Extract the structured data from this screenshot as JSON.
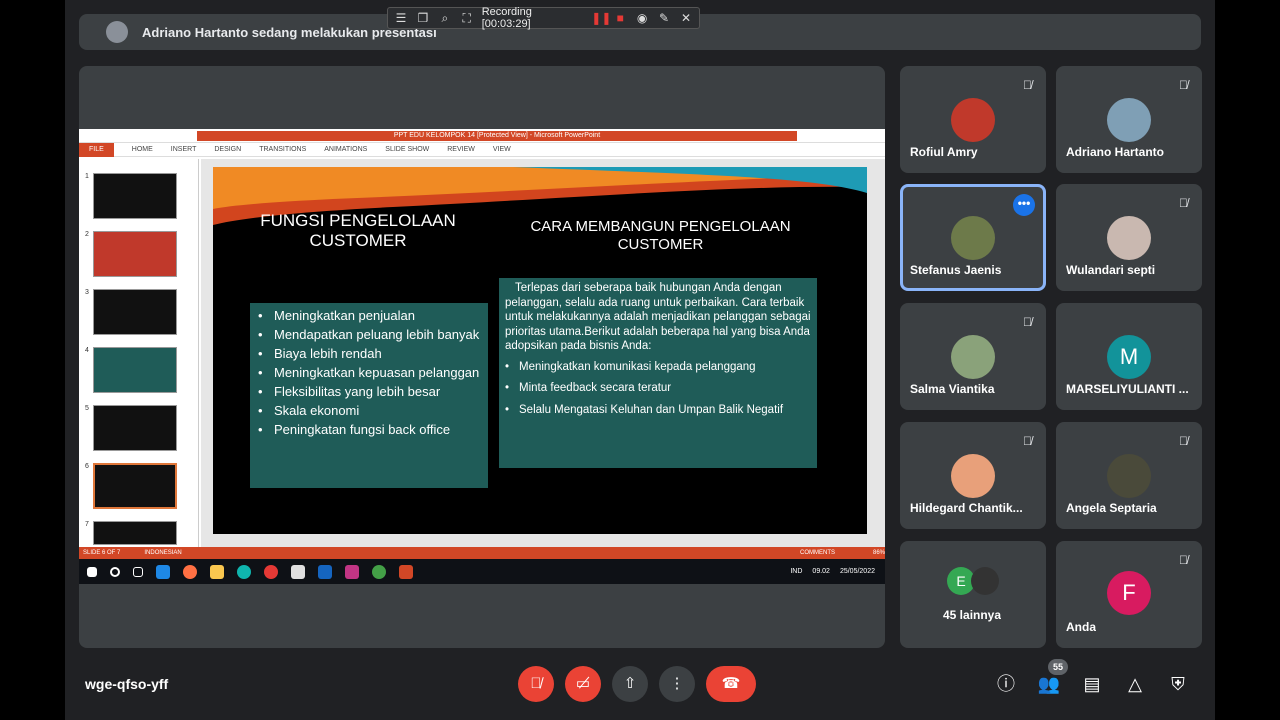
{
  "banner": {
    "text": "Adriano Hartanto sedang melakukan presentasi"
  },
  "recording": {
    "label": "Recording [00:03:29]"
  },
  "ppt": {
    "window_title": "PPT EDU KELOMPOK 14 [Protected View] - Microsoft PowerPoint",
    "ribbon_tabs": [
      "FILE",
      "HOME",
      "INSERT",
      "DESIGN",
      "TRANSITIONS",
      "ANIMATIONS",
      "SLIDE SHOW",
      "REVIEW",
      "VIEW"
    ],
    "thumbnail_numbers": [
      "1",
      "2",
      "3",
      "4",
      "5",
      "6",
      "7"
    ],
    "selected_slide": 6,
    "status_slide": "SLIDE 6 OF 7",
    "status_lang": "INDONESIAN",
    "status_comments": "COMMENTS",
    "status_zoom": "86%"
  },
  "slide": {
    "title_left": "FUNGSI PENGELOLAAN CUSTOMER",
    "title_right": "CARA MEMBANGUN PENGELOLAAN CUSTOMER",
    "left_bullets": [
      "Meningkatkan penjualan",
      "Mendapatkan peluang lebih banyak",
      "Biaya lebih rendah",
      "Meningkatkan kepuasan pelanggan",
      "Fleksibilitas yang lebih besar",
      "Skala ekonomi",
      "Peningkatan fungsi back office"
    ],
    "right_paragraph": "Terlepas dari seberapa baik hubungan Anda dengan pelanggan, selalu ada ruang untuk perbaikan. Cara terbaik untuk melakukannya adalah menjadikan pelanggan sebagai prioritas utama.Berikut adalah beberapa hal yang bisa Anda adopsikan pada bisnis Anda:",
    "right_bullets": [
      "Meningkatkan komunikasi kepada pelanggang",
      "Minta feedback secara teratur",
      "Selalu Mengatasi Keluhan dan Umpan Balik Negatif"
    ]
  },
  "taskbar": {
    "lang": "IND",
    "time": "09.02",
    "date": "25/05/2022"
  },
  "participants": [
    {
      "name": "Rofiul Amry",
      "initial": "",
      "color": "#c0392b",
      "muted": true
    },
    {
      "name": "Adriano Hartanto",
      "initial": "",
      "color": "#7f9fb5",
      "muted": true
    },
    {
      "name": "Stefanus Jaenis",
      "initial": "",
      "color": "#6d7a4a",
      "muted": false
    },
    {
      "name": "Wulandari septi",
      "initial": "",
      "color": "#c9b8b0",
      "muted": true
    },
    {
      "name": "Salma Viantika",
      "initial": "",
      "color": "#8aa27a",
      "muted": true
    },
    {
      "name": "MARSELIYULIANTI ...",
      "initial": "M",
      "color": "#12939a",
      "muted": false
    },
    {
      "name": "Hildegard Chantik...",
      "initial": "",
      "color": "#e8a07a",
      "muted": true
    },
    {
      "name": "Angela Septaria",
      "initial": "",
      "color": "#4a4a3a",
      "muted": true
    },
    {
      "name": "45 lainnya",
      "initial": "E",
      "color": "#34a853",
      "muted": false
    },
    {
      "name": "Anda",
      "initial": "F",
      "color": "#d81b60",
      "muted": true
    }
  ],
  "meeting": {
    "code": "wge-qfso-yff",
    "participant_count": "55"
  }
}
